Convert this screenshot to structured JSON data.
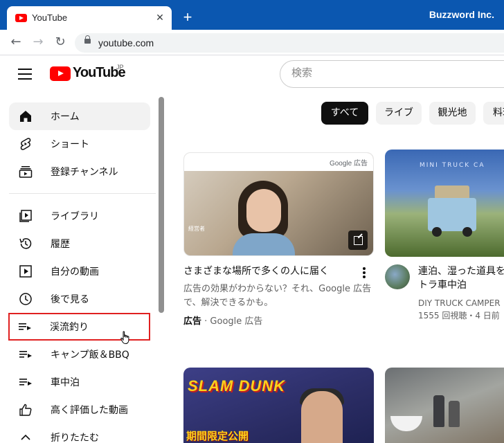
{
  "browser": {
    "tab_title": "YouTube",
    "tab_close": "✕",
    "new_tab": "+",
    "profile_name": "Buzzword Inc.",
    "url": "youtube.com",
    "nav": {
      "back": "←",
      "forward": "→",
      "reload": "↻"
    }
  },
  "header": {
    "logo_text": "YouTube",
    "logo_region": "JP",
    "search_placeholder": "検索"
  },
  "sidebar": {
    "items": [
      {
        "label": "ホーム",
        "icon": "home-icon",
        "active": true
      },
      {
        "label": "ショート",
        "icon": "shorts-icon"
      },
      {
        "label": "登録チャンネル",
        "icon": "subscriptions-icon"
      },
      {
        "label": "ライブラリ",
        "icon": "library-icon"
      },
      {
        "label": "履歴",
        "icon": "history-icon"
      },
      {
        "label": "自分の動画",
        "icon": "your-videos-icon"
      },
      {
        "label": "後で見る",
        "icon": "watch-later-icon"
      },
      {
        "label": "渓流釣り",
        "icon": "playlist-icon",
        "highlighted": true
      },
      {
        "label": "キャンプ飯＆BBQ",
        "icon": "playlist-icon"
      },
      {
        "label": "車中泊",
        "icon": "playlist-icon"
      },
      {
        "label": "高く評価した動画",
        "icon": "thumbs-up-icon"
      },
      {
        "label": "折りたたむ",
        "icon": "chevron-up-icon"
      }
    ]
  },
  "chips": [
    "すべて",
    "ライブ",
    "観光地",
    "料理"
  ],
  "videos": [
    {
      "type": "ad",
      "badge": "Google 広告",
      "thumb_caption": "経営者",
      "title": "さまざまな場所で多くの人に届く",
      "description": "広告の効果がわからない？それ、Google 広告で、解決できるかも。",
      "ad_label": "広告",
      "ad_source": " · Google 広告"
    },
    {
      "title": "連泊、湿った道具を トラ車中泊",
      "thumb_caption": "MINI TRUCK CA",
      "channel": "DIY TRUCK CAMPER",
      "meta": "1555 回視聴・4 日前"
    },
    {
      "thumb_logo": "SLAM DUNK",
      "thumb_banner": "期間限定公開"
    },
    {}
  ],
  "colors": {
    "chrome_blue": "#0b57b0",
    "youtube_red": "#ff0000",
    "highlight_red": "#e02020"
  }
}
